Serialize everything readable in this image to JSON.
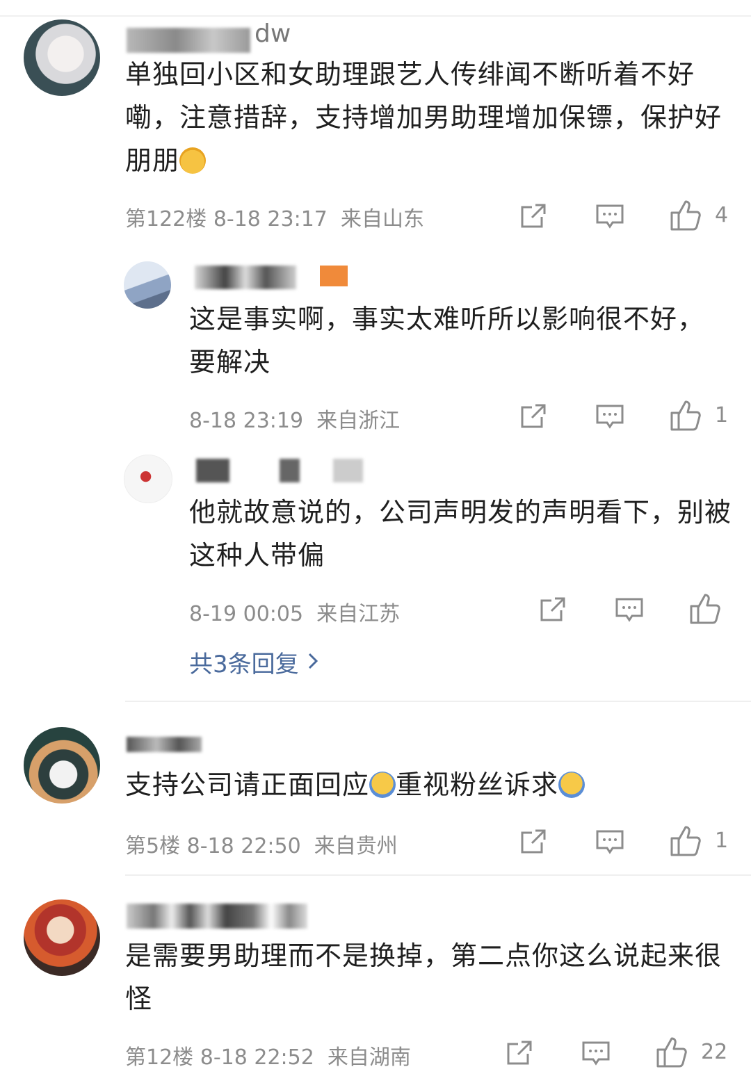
{
  "comments": [
    {
      "username": "dw",
      "text": "单独回小区和女助理跟艺人传绯闻不断听着不好嘞，注意措辞，支持增加男助理增加保镖，保护好朋朋",
      "emoji": "crying-face",
      "floor": "第122楼",
      "time": "8-18 23:17",
      "location": "来自山东",
      "likes": "4",
      "replies": [
        {
          "text": "这是事实啊，事实太难听所以影响很不好，要解决",
          "time": "8-18 23:19",
          "location": "来自浙江",
          "likes": "1"
        },
        {
          "text": "他就故意说的，公司声明发的声明看下，别被这种人带偏",
          "time": "8-19 00:05",
          "location": "来自江苏",
          "likes": ""
        }
      ],
      "more_replies": "共3条回复"
    },
    {
      "text": "支持公司请正面回应",
      "text2": "重视粉丝诉求",
      "emoji": "raising-hand",
      "floor": "第5楼",
      "time": "8-18 22:50",
      "location": "来自贵州",
      "likes": "1"
    },
    {
      "text": "是需要男助理而不是换掉，第二点你这么说起来很怪",
      "floor": "第12楼",
      "time": "8-18 22:52",
      "location": "来自湖南",
      "likes": "22"
    }
  ],
  "colors": {
    "meta": "#8c8c8c",
    "link": "#4a6a9c",
    "text": "#1f1f1f"
  }
}
